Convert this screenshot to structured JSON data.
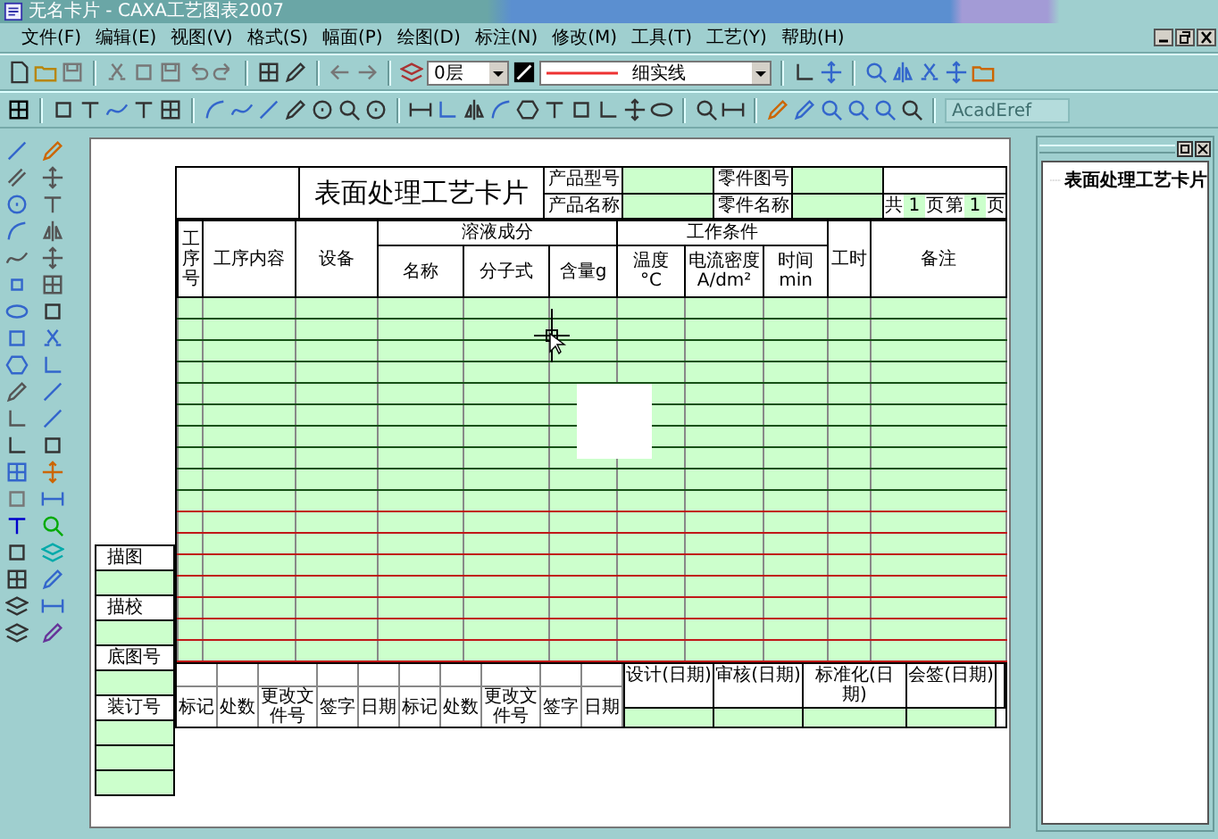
{
  "window": {
    "title": "无名卡片 - CAXA工艺图表2007"
  },
  "menu": [
    "文件(F)",
    "编辑(E)",
    "视图(V)",
    "格式(S)",
    "幅面(P)",
    "绘图(D)",
    "标注(N)",
    "修改(M)",
    "工具(T)",
    "工艺(Y)",
    "帮助(H)"
  ],
  "toolbar": {
    "layer": "0层",
    "linetype": "细实线",
    "font_field": {
      "value": "AcadEref",
      "disabled": true
    }
  },
  "card": {
    "title": "表面处理工艺卡片",
    "info": [
      {
        "label": "产品型号"
      },
      {
        "label": "零件图号"
      },
      {
        "label": "产品名称"
      },
      {
        "label": "零件名称"
      }
    ],
    "page": [
      {
        "kind": "label",
        "text": "共"
      },
      {
        "kind": "value",
        "text": "1"
      },
      {
        "kind": "label",
        "text": "页"
      },
      {
        "kind": "label",
        "text": "第"
      },
      {
        "kind": "value",
        "text": "1"
      },
      {
        "kind": "label",
        "text": "页"
      }
    ],
    "columns": [
      {
        "label": "工序号"
      },
      {
        "label": "工序内容"
      },
      {
        "label": "设备"
      },
      {
        "group": "溶液成分",
        "children": [
          {
            "label": "名称"
          },
          {
            "label": "分子式"
          },
          {
            "label": "含量g"
          }
        ]
      },
      {
        "group": "工作条件",
        "children": [
          {
            "label": "温度",
            "unit": "°C"
          },
          {
            "label": "电流密度",
            "unit": "A/dm²"
          },
          {
            "label": "时间",
            "unit": "min"
          }
        ]
      },
      {
        "label": "工时"
      },
      {
        "label": "备注"
      }
    ],
    "side_labels": [
      "描图",
      "描校",
      "底图号",
      "装订号"
    ],
    "signature": [
      "标记",
      "处数",
      "更改文件号",
      "签字",
      "日期",
      "标记",
      "处数",
      "更改文件号",
      "签字",
      "日期"
    ],
    "approvals": [
      "设计(日期)",
      "审核(日期)",
      "标准化(日期)",
      "会签(日期)"
    ]
  },
  "tree": {
    "items": [
      {
        "label": "表面处理工艺卡片"
      }
    ]
  }
}
